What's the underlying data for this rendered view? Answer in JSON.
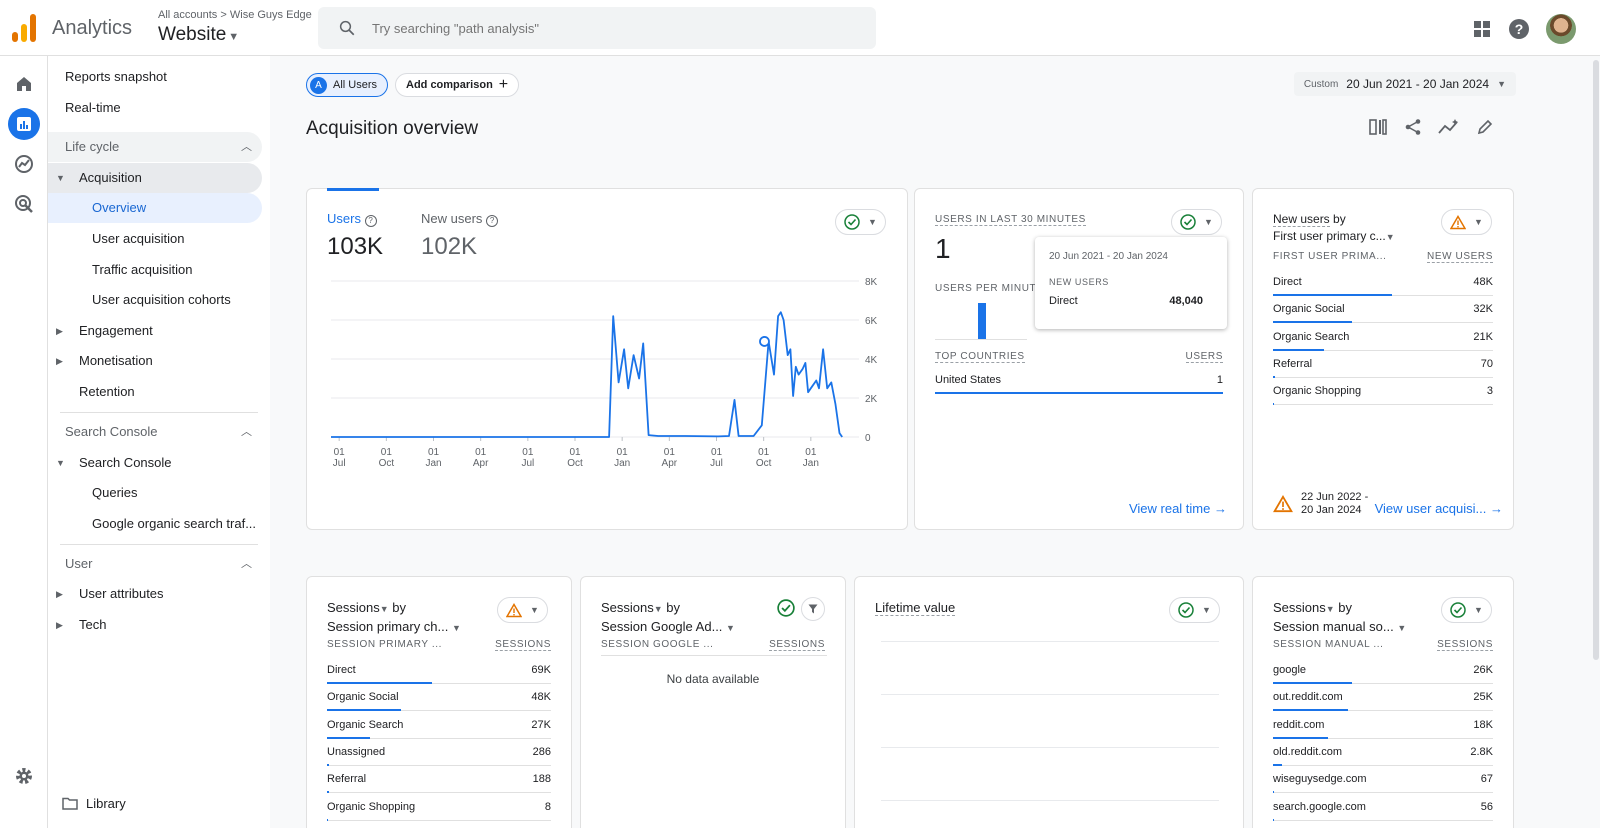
{
  "header": {
    "app_name": "Analytics",
    "breadcrumb_accounts": "All accounts",
    "breadcrumb_sep": ">",
    "breadcrumb_account": "Wise Guys Edge",
    "property": "Website",
    "search_placeholder": "Try searching \"path analysis\"",
    "icons": [
      "apps-grid-icon",
      "help-icon",
      "avatar"
    ]
  },
  "rail": {
    "icons": [
      "home-icon",
      "reports-icon",
      "explore-icon",
      "advertising-icon",
      "settings-icon"
    ]
  },
  "nav": {
    "reports_snapshot": "Reports snapshot",
    "realtime": "Real-time",
    "lifecycle": "Life cycle",
    "acquisition": "Acquisition",
    "overview": "Overview",
    "user_acquisition": "User acquisition",
    "traffic_acquisition": "Traffic acquisition",
    "user_acquisition_cohorts": "User acquisition cohorts",
    "engagement": "Engagement",
    "monetisation": "Monetisation",
    "retention": "Retention",
    "search_console_section": "Search Console",
    "search_console": "Search Console",
    "queries": "Queries",
    "google_organic": "Google organic search traf...",
    "user_section": "User",
    "user_attributes": "User attributes",
    "tech": "Tech",
    "library": "Library"
  },
  "main": {
    "chip_all_badge": "A",
    "chip_all_users": "All Users",
    "chip_add": "Add comparison",
    "date_label": "Custom",
    "date_value": "20 Jun 2021 - 20 Jan 2024",
    "title": "Acquisition overview"
  },
  "users_card": {
    "users_label": "Users",
    "users_value": "103K",
    "new_users_label": "New users",
    "new_users_value": "102K"
  },
  "chart_data": {
    "type": "line",
    "title": "",
    "x_ticks": [
      [
        "01",
        "Jul"
      ],
      [
        "01",
        "Oct"
      ],
      [
        "01",
        "Jan"
      ],
      [
        "01",
        "Apr"
      ],
      [
        "01",
        "Jul"
      ],
      [
        "01",
        "Oct"
      ],
      [
        "01",
        "Jan"
      ],
      [
        "01",
        "Apr"
      ],
      [
        "01",
        "Jul"
      ],
      [
        "01",
        "Oct"
      ],
      [
        "01",
        "Jan"
      ]
    ],
    "y_ticks": [
      "8K",
      "6K",
      "4K",
      "2K",
      "0"
    ],
    "ylim": [
      0,
      8000
    ],
    "series": [
      {
        "values": [
          [
            0,
            0
          ],
          [
            10.2,
            0
          ],
          [
            10.35,
            6200
          ],
          [
            10.55,
            2800
          ],
          [
            10.75,
            4500
          ],
          [
            10.9,
            2500
          ],
          [
            11.1,
            4200
          ],
          [
            11.3,
            3000
          ],
          [
            11.45,
            4800
          ],
          [
            11.65,
            100
          ],
          [
            12,
            50
          ],
          [
            13,
            50
          ],
          [
            14.2,
            30
          ],
          [
            14.6,
            50
          ],
          [
            14.8,
            1900
          ],
          [
            14.95,
            50
          ],
          [
            15.5,
            50
          ],
          [
            15.8,
            600
          ],
          [
            16.05,
            4900
          ],
          [
            16.25,
            3200
          ],
          [
            16.4,
            6200
          ],
          [
            16.5,
            6400
          ],
          [
            16.6,
            6000
          ],
          [
            16.75,
            4200
          ],
          [
            16.85,
            4500
          ],
          [
            16.95,
            2100
          ],
          [
            17.05,
            3600
          ],
          [
            17.15,
            3200
          ],
          [
            17.3,
            3500
          ],
          [
            17.4,
            3800
          ],
          [
            17.5,
            2300
          ],
          [
            17.65,
            2600
          ],
          [
            17.8,
            2900
          ],
          [
            17.9,
            2500
          ],
          [
            18.05,
            4500
          ],
          [
            18.2,
            2500
          ],
          [
            18.35,
            2800
          ],
          [
            18.5,
            1700
          ],
          [
            18.65,
            200
          ],
          [
            18.75,
            0
          ]
        ]
      }
    ],
    "marker_point": [
      15.9,
      4900
    ]
  },
  "realtime_card": {
    "title": "USERS IN LAST 30 MINUTES",
    "value": "1",
    "per_minute": "USERS PER MINUTE",
    "per_minute_bar": 1,
    "tooltip_date": "20 Jun 2021 - 20 Jan 2024",
    "tooltip_label": "NEW USERS",
    "tooltip_row_label": "Direct",
    "tooltip_row_value": "48,040",
    "countries_head": "TOP COUNTRIES",
    "users_head": "USERS",
    "country": "United States",
    "country_value": "1",
    "link": "View real time"
  },
  "new_users_card": {
    "title_line1": "New users",
    "title_by": "by",
    "title_line2": "First user primary c...",
    "col1": "FIRST USER PRIMA...",
    "col2": "NEW USERS",
    "rows": [
      {
        "label": "Direct",
        "value": "48K",
        "pct": 0.54
      },
      {
        "label": "Organic Social",
        "value": "32K",
        "pct": 0.36
      },
      {
        "label": "Organic Search",
        "value": "21K",
        "pct": 0.23
      },
      {
        "label": "Referral",
        "value": "70",
        "pct": 0.01
      },
      {
        "label": "Organic Shopping",
        "value": "3",
        "pct": 0.005
      }
    ],
    "date_note_line1": "22 Jun 2022 -",
    "date_note_line2": "20 Jan 2024",
    "link": "View user acquisi..."
  },
  "sessions_channel_card": {
    "metric": "Sessions",
    "by": "by",
    "dimension": "Session primary ch...",
    "col1": "SESSION PRIMARY ...",
    "col2": "SESSIONS",
    "rows": [
      {
        "label": "Direct",
        "value": "69K",
        "pct": 0.47
      },
      {
        "label": "Organic Social",
        "value": "48K",
        "pct": 0.33
      },
      {
        "label": "Organic Search",
        "value": "27K",
        "pct": 0.19
      },
      {
        "label": "Unassigned",
        "value": "286",
        "pct": 0.01
      },
      {
        "label": "Referral",
        "value": "188",
        "pct": 0.01
      },
      {
        "label": "Organic Shopping",
        "value": "8",
        "pct": 0.0
      }
    ]
  },
  "sessions_ads_card": {
    "metric": "Sessions",
    "by": "by",
    "dimension": "Session Google Ad...",
    "col1": "SESSION GOOGLE ...",
    "col2": "SESSIONS",
    "empty": "No data available"
  },
  "lifetime_card": {
    "title": "Lifetime value"
  },
  "sessions_manual_card": {
    "metric": "Sessions",
    "by": "by",
    "dimension": "Session manual so...",
    "col1": "SESSION MANUAL ...",
    "col2": "SESSIONS",
    "rows": [
      {
        "label": "google",
        "value": "26K",
        "pct": 0.36
      },
      {
        "label": "out.reddit.com",
        "value": "25K",
        "pct": 0.34
      },
      {
        "label": "reddit.com",
        "value": "18K",
        "pct": 0.25
      },
      {
        "label": "old.reddit.com",
        "value": "2.8K",
        "pct": 0.04
      },
      {
        "label": "wiseguysedge.com",
        "value": "67",
        "pct": 0.002
      },
      {
        "label": "search.google.com",
        "value": "56",
        "pct": 0.002
      }
    ]
  },
  "colors": {
    "accent": "#1a73e8",
    "ok": "#188038",
    "warn": "#e37400"
  }
}
